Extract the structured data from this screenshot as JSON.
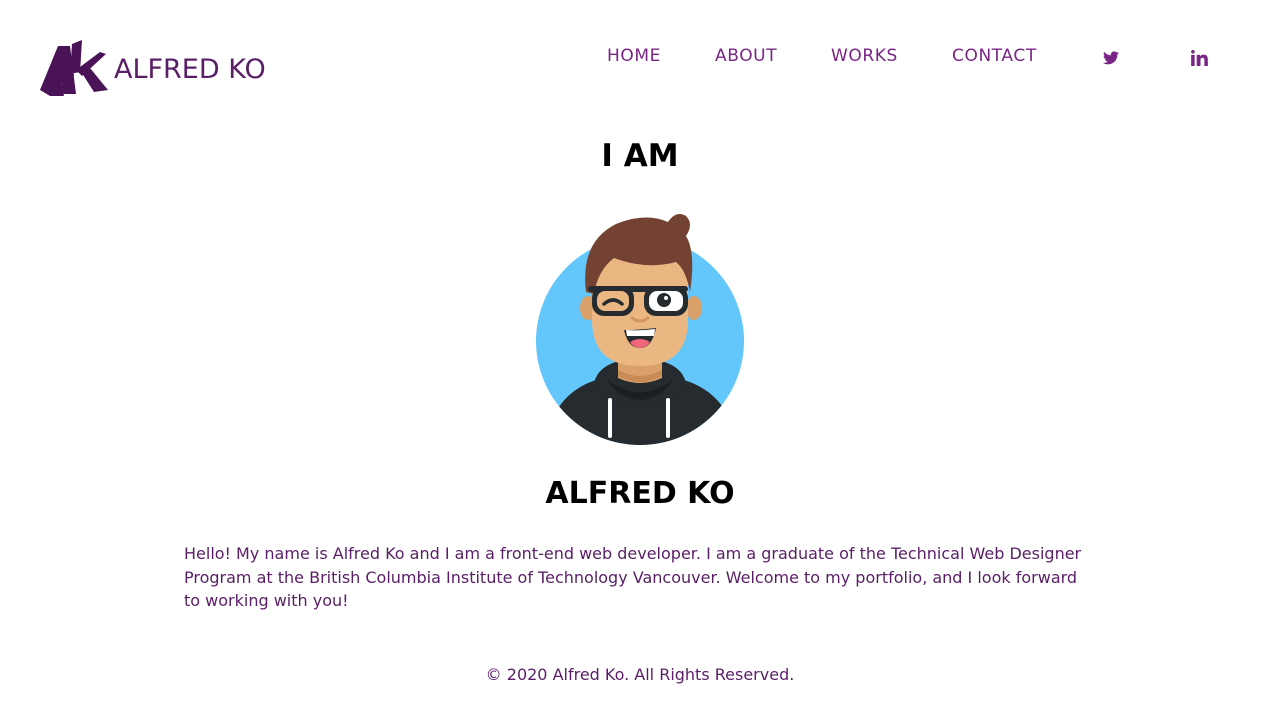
{
  "header": {
    "brand_name": "ALFRED KO",
    "logo_icon": "ak-monogram-logo",
    "nav": [
      {
        "label": "HOME"
      },
      {
        "label": "ABOUT"
      },
      {
        "label": "WORKS"
      },
      {
        "label": "CONTACT"
      }
    ],
    "social": [
      {
        "icon": "twitter-icon"
      },
      {
        "icon": "linkedin-icon"
      }
    ]
  },
  "main": {
    "intro_heading": "I AM",
    "avatar_icon": "cartoon-avatar-winking",
    "name_heading": "ALFRED KO",
    "bio": "Hello! My name is Alfred Ko and I am a front-end web developer. I am a graduate of the Technical Web Designer Program at the British Columbia Institute of Technology Vancouver. Welcome to my portfolio, and I look forward to working with you!"
  },
  "footer": {
    "copyright": "© 2020 Alfred Ko. All Rights Reserved."
  },
  "colors": {
    "brand": "#5a1e66",
    "nav": "#7a2585",
    "avatar_bg": "#63c7fb"
  }
}
